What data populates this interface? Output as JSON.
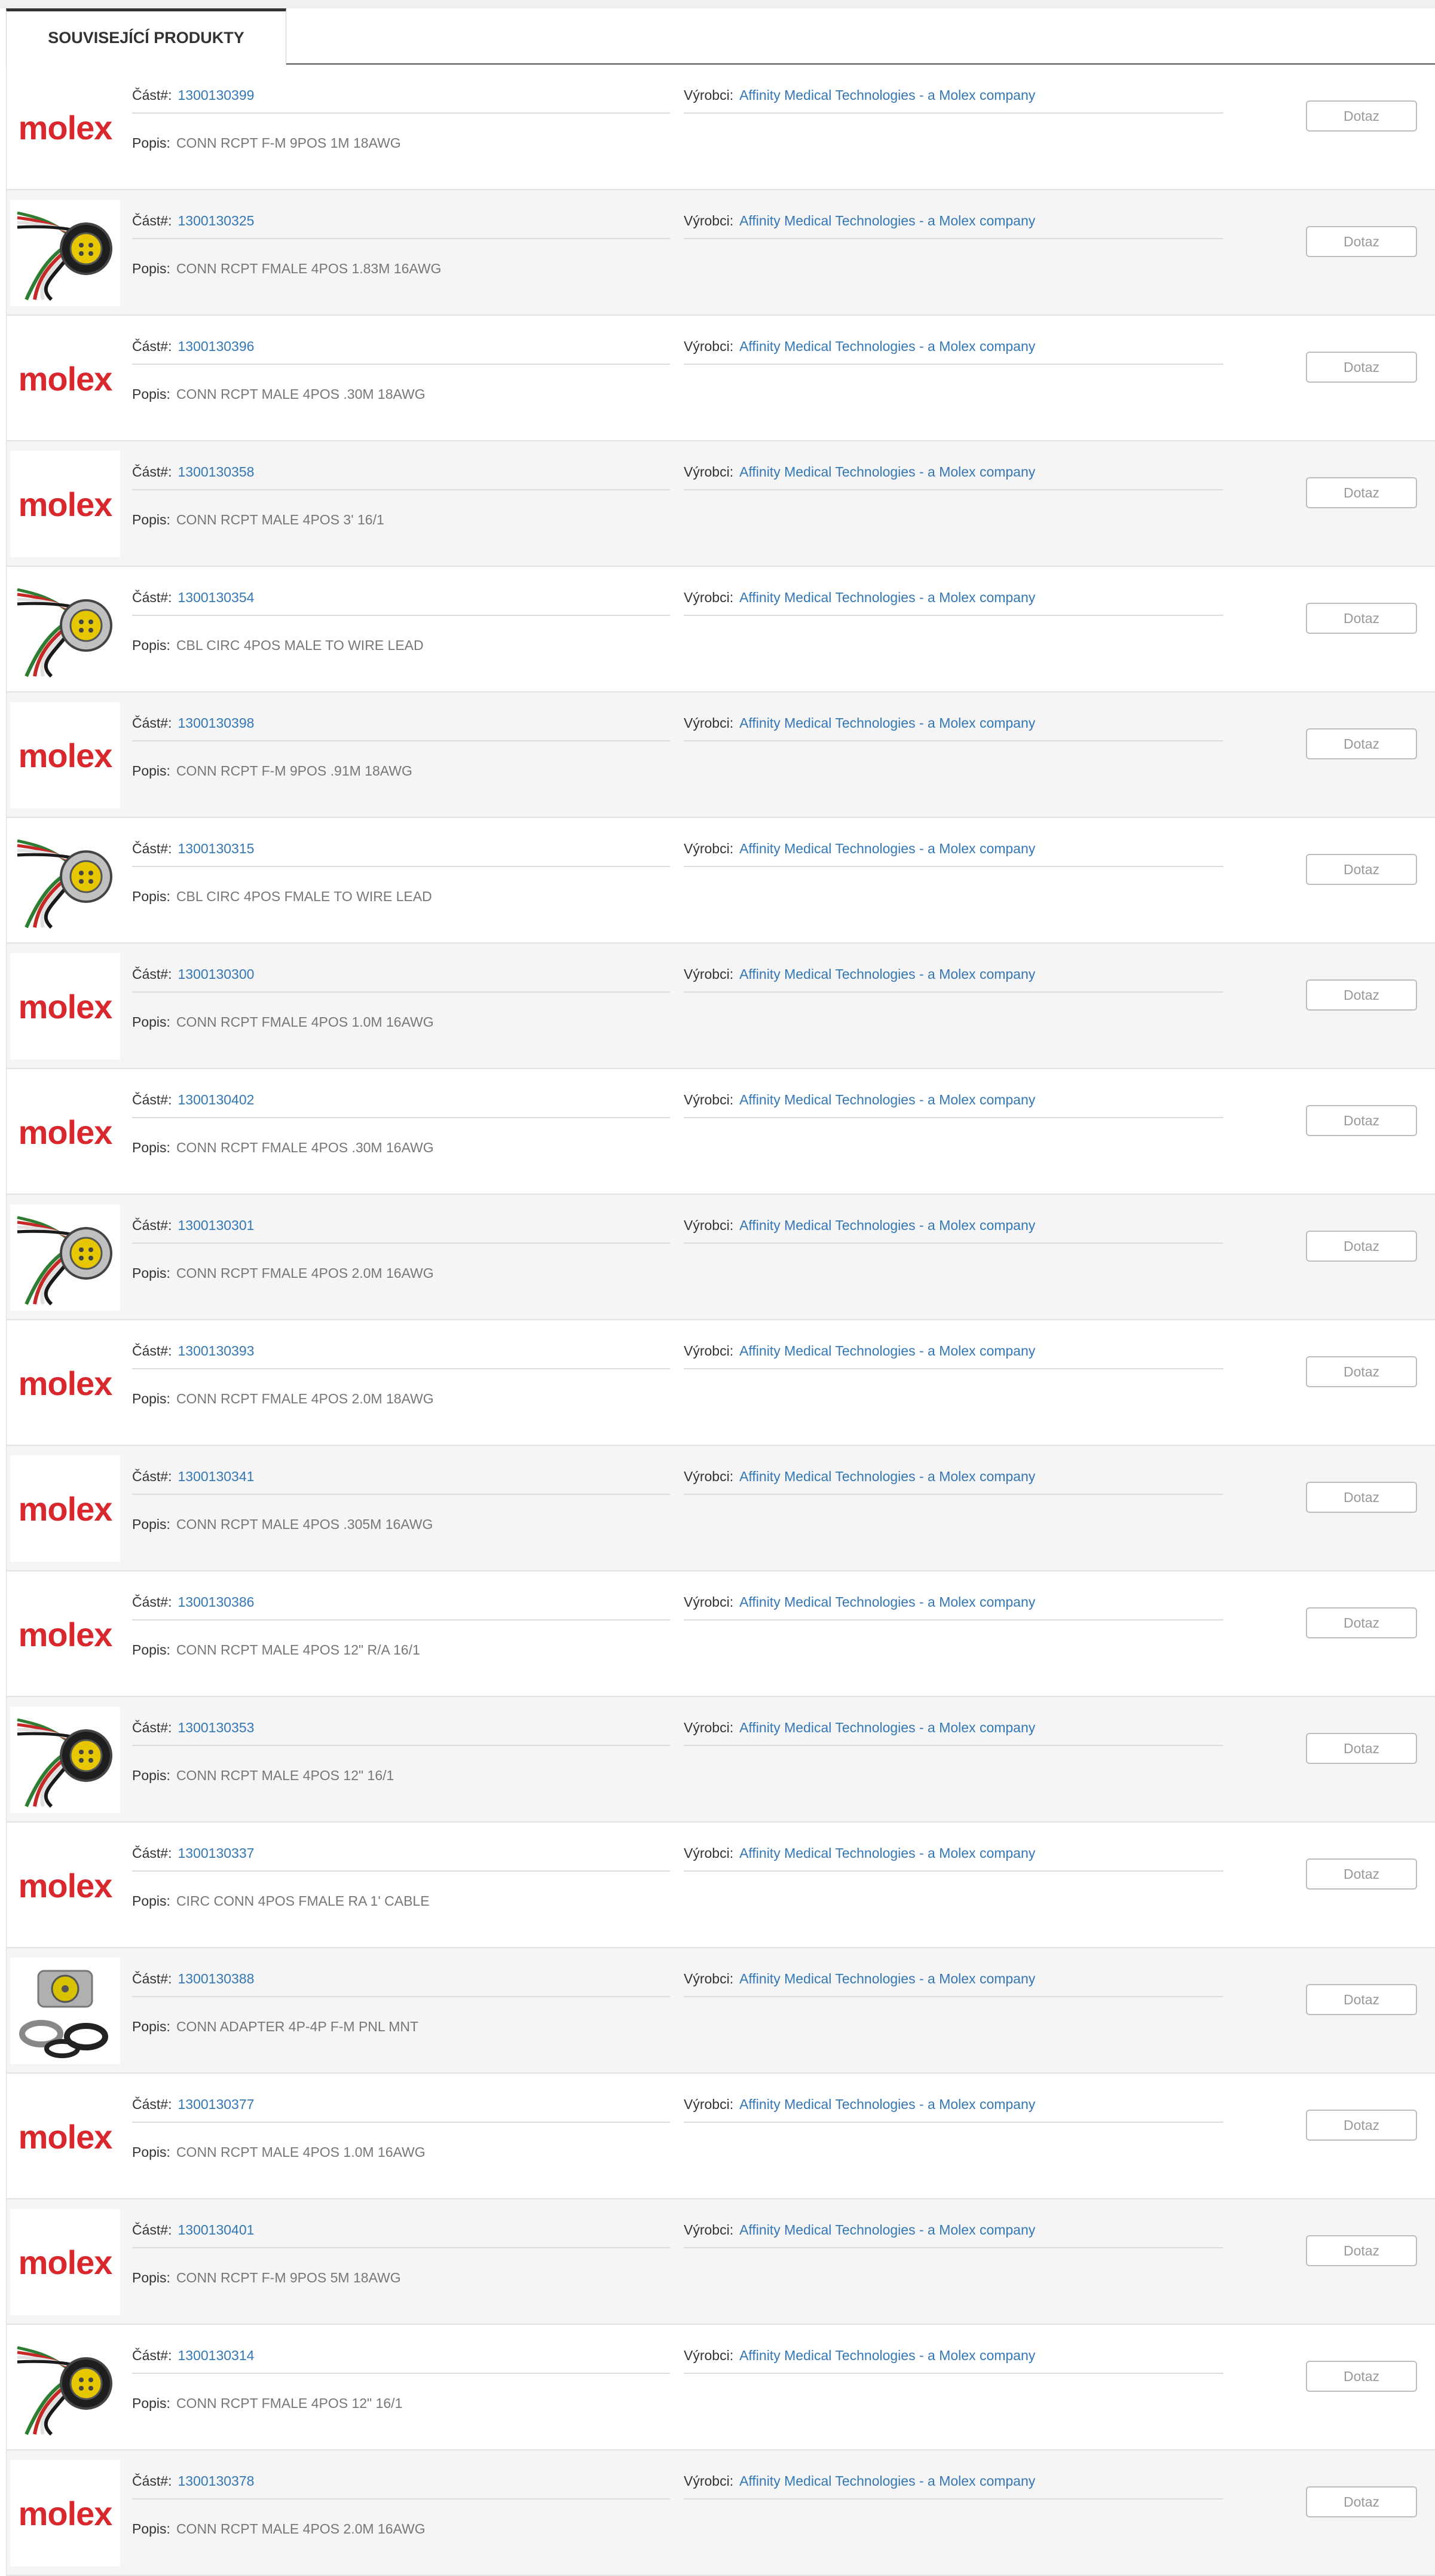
{
  "tab": {
    "label": "SOUVISEJÍCÍ PRODUKTY"
  },
  "labels": {
    "part": "Část#:",
    "description": "Popis:",
    "manufacturer": "Výrobci:",
    "inquiry_button": "Dotaz"
  },
  "brand": {
    "logo_text": "molex",
    "logo_color": "#d9272e",
    "link_color": "#3477b5"
  },
  "products": [
    {
      "part": "1300130399",
      "manufacturer": "Affinity Medical Technologies - a Molex company",
      "description": "CONN RCPT F-M 9POS 1M 18AWG",
      "image": "molex-logo"
    },
    {
      "part": "1300130325",
      "manufacturer": "Affinity Medical Technologies - a Molex company",
      "description": "CONN RCPT FMALE 4POS 1.83M 16AWG",
      "image": "connector-black-photo"
    },
    {
      "part": "1300130396",
      "manufacturer": "Affinity Medical Technologies - a Molex company",
      "description": "CONN RCPT MALE 4POS .30M 18AWG",
      "image": "molex-logo"
    },
    {
      "part": "1300130358",
      "manufacturer": "Affinity Medical Technologies - a Molex company",
      "description": "CONN RCPT MALE 4POS 3' 16/1",
      "image": "molex-logo"
    },
    {
      "part": "1300130354",
      "manufacturer": "Affinity Medical Technologies - a Molex company",
      "description": "CBL CIRC 4POS MALE TO WIRE LEAD",
      "image": "connector-silver-photo"
    },
    {
      "part": "1300130398",
      "manufacturer": "Affinity Medical Technologies - a Molex company",
      "description": "CONN RCPT F-M 9POS .91M 18AWG",
      "image": "molex-logo"
    },
    {
      "part": "1300130315",
      "manufacturer": "Affinity Medical Technologies - a Molex company",
      "description": "CBL CIRC 4POS FMALE TO WIRE LEAD",
      "image": "connector-silver-photo"
    },
    {
      "part": "1300130300",
      "manufacturer": "Affinity Medical Technologies - a Molex company",
      "description": "CONN RCPT FMALE 4POS 1.0M 16AWG",
      "image": "molex-logo"
    },
    {
      "part": "1300130402",
      "manufacturer": "Affinity Medical Technologies - a Molex company",
      "description": "CONN RCPT FMALE 4POS .30M 16AWG",
      "image": "molex-logo"
    },
    {
      "part": "1300130301",
      "manufacturer": "Affinity Medical Technologies - a Molex company",
      "description": "CONN RCPT FMALE 4POS 2.0M 16AWG",
      "image": "connector-silver-photo"
    },
    {
      "part": "1300130393",
      "manufacturer": "Affinity Medical Technologies - a Molex company",
      "description": "CONN RCPT FMALE 4POS 2.0M 18AWG",
      "image": "molex-logo"
    },
    {
      "part": "1300130341",
      "manufacturer": "Affinity Medical Technologies - a Molex company",
      "description": "CONN RCPT MALE 4POS .305M 16AWG",
      "image": "molex-logo"
    },
    {
      "part": "1300130386",
      "manufacturer": "Affinity Medical Technologies - a Molex company",
      "description": "CONN RCPT MALE 4POS 12\" R/A 16/1",
      "image": "molex-logo"
    },
    {
      "part": "1300130353",
      "manufacturer": "Affinity Medical Technologies - a Molex company",
      "description": "CONN RCPT MALE 4POS 12\" 16/1",
      "image": "connector-black-photo"
    },
    {
      "part": "1300130337",
      "manufacturer": "Affinity Medical Technologies - a Molex company",
      "description": "CIRC CONN 4POS FMALE RA 1' CABLE",
      "image": "molex-logo"
    },
    {
      "part": "1300130388",
      "manufacturer": "Affinity Medical Technologies - a Molex company",
      "description": "CONN ADAPTER 4P-4P F-M PNL MNT",
      "image": "adapter-photo"
    },
    {
      "part": "1300130377",
      "manufacturer": "Affinity Medical Technologies - a Molex company",
      "description": "CONN RCPT MALE 4POS 1.0M 16AWG",
      "image": "molex-logo"
    },
    {
      "part": "1300130401",
      "manufacturer": "Affinity Medical Technologies - a Molex company",
      "description": "CONN RCPT F-M 9POS 5M 18AWG",
      "image": "molex-logo"
    },
    {
      "part": "1300130314",
      "manufacturer": "Affinity Medical Technologies - a Molex company",
      "description": "CONN RCPT FMALE 4POS 12\" 16/1",
      "image": "connector-black-photo"
    },
    {
      "part": "1300130378",
      "manufacturer": "Affinity Medical Technologies - a Molex company",
      "description": "CONN RCPT MALE 4POS 2.0M 16AWG",
      "image": "molex-logo"
    }
  ]
}
